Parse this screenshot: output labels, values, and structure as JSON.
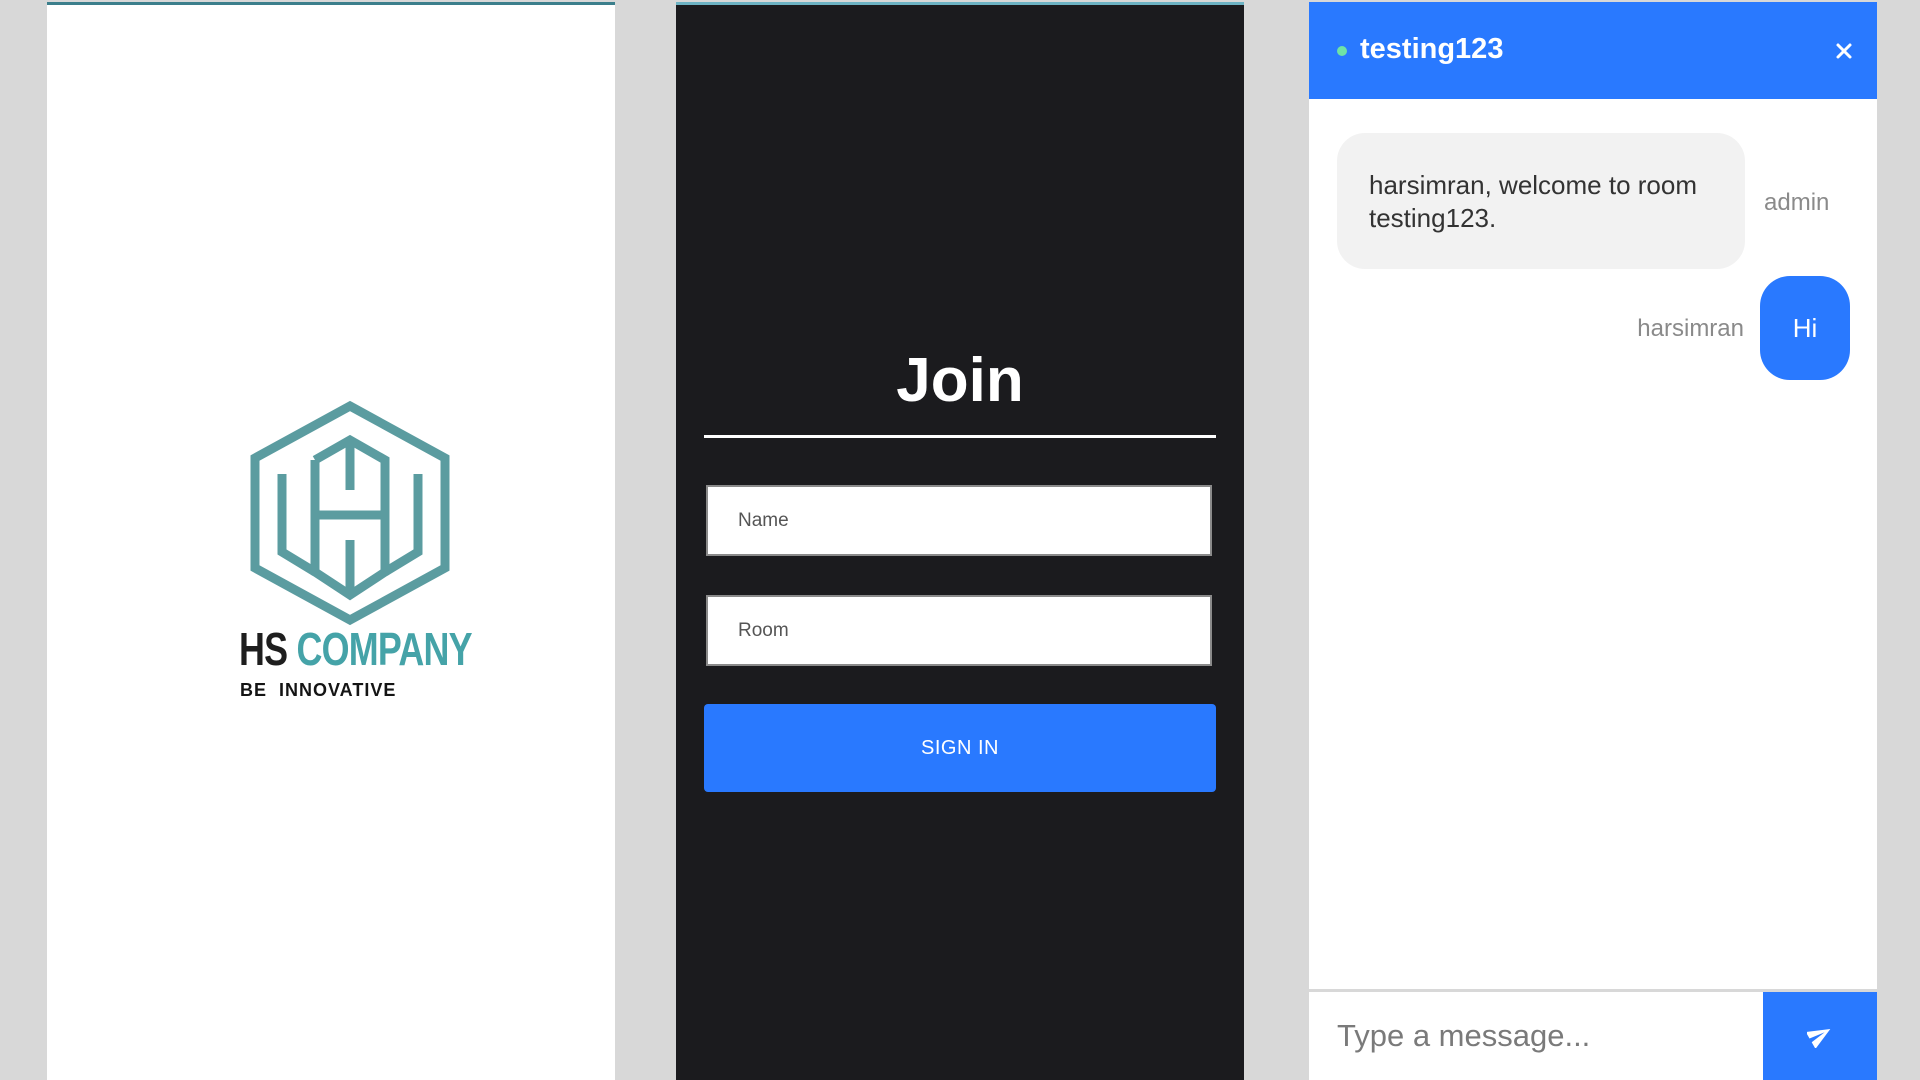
{
  "colors": {
    "background": "#d8d8d8",
    "accent_blue": "#2979ff",
    "dark_panel": "#1b1b1e",
    "brand_teal": "#45a3a8",
    "logo_teal": "#5b9ca0",
    "online_green": "#6fe3a6"
  },
  "splash": {
    "logo_icon": "hexagon-h-logo-icon",
    "brand_primary": "HS",
    "brand_secondary": "COMPANY",
    "tagline": "BE INNOVATIVE"
  },
  "join": {
    "title": "Join",
    "name_placeholder": "Name",
    "room_placeholder": "Room",
    "signin_label": "SIGN IN"
  },
  "chat": {
    "room_name": "testing123",
    "online_icon": "online-dot-icon",
    "close_icon": "close-icon",
    "messages": [
      {
        "sender": "admin",
        "text": "harsimran, welcome to room testing123."
      },
      {
        "sender": "harsimran",
        "text": "Hi"
      }
    ],
    "input_placeholder": "Type a message...",
    "send_icon": "send-icon"
  }
}
